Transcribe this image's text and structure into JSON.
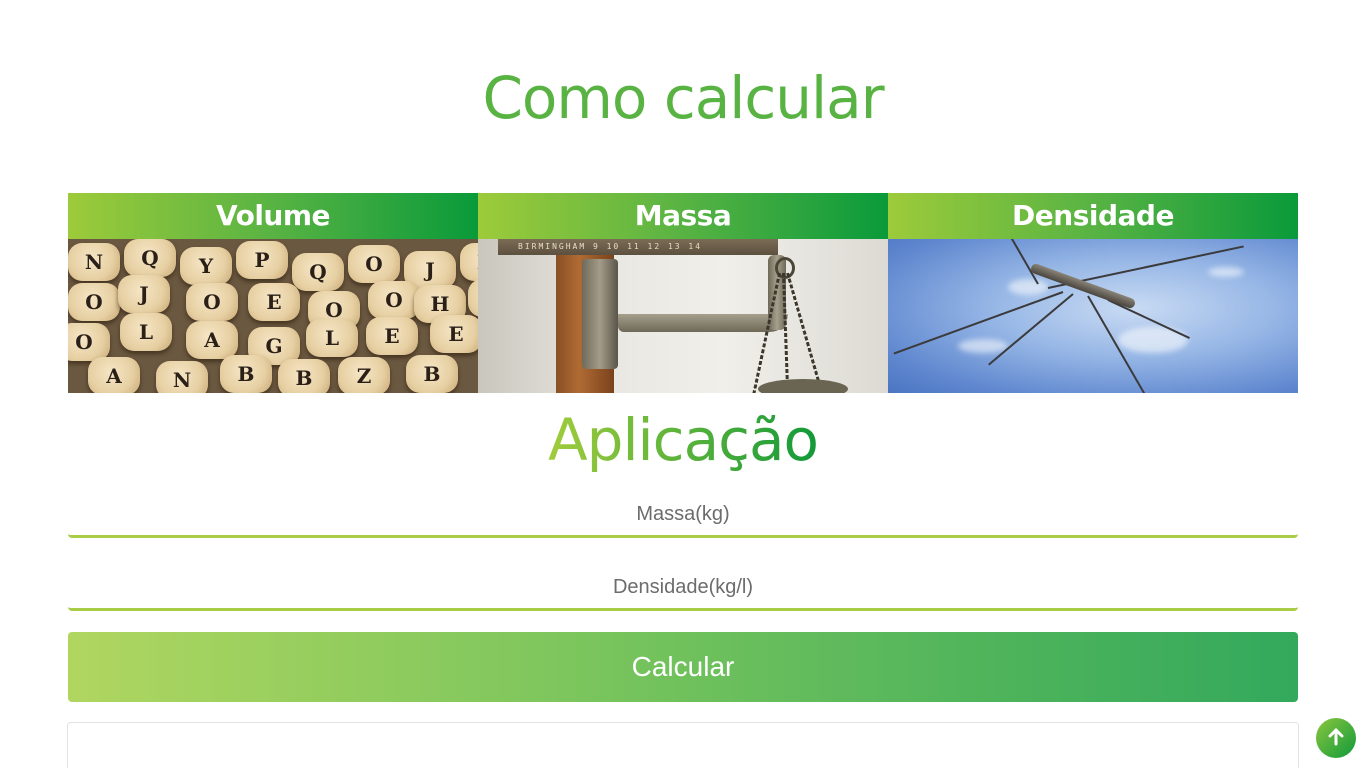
{
  "page": {
    "title": "Como calcular",
    "subtitle": "Aplicação"
  },
  "cards": [
    {
      "label": "Volume",
      "image": "wooden-letter-cubes"
    },
    {
      "label": "Massa",
      "image": "hanging-scale"
    },
    {
      "label": "Densidade",
      "image": "water-strider-on-water"
    }
  ],
  "volume_letters": [
    "A",
    "E",
    "G",
    "L",
    "E",
    "B",
    "Z",
    "O",
    "H",
    "Q",
    "J",
    "P",
    "O",
    "Y",
    "Ñ",
    "N"
  ],
  "massa_ruler_text": "BIRMINGHAM  9  10  11  12  13  14",
  "form": {
    "massa_placeholder": "Massa(kg)",
    "densidade_placeholder": "Densidade(kg/l)",
    "calculate_label": "Calcular"
  },
  "colors": {
    "accent_green": "#58b343",
    "light_green": "#a9cd46",
    "dark_green": "#0a9a3a"
  },
  "icons": {
    "scroll_top": "arrow-up-icon"
  }
}
